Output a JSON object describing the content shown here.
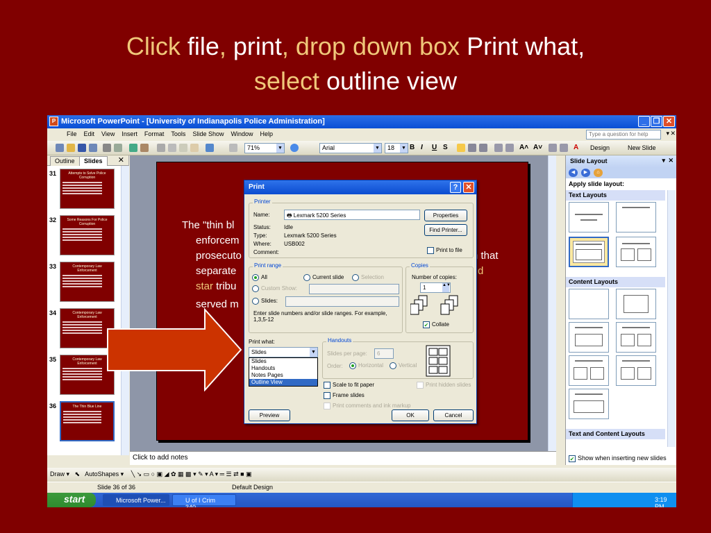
{
  "slide_title": {
    "parts": [
      {
        "text": "Click ",
        "accent": true
      },
      {
        "text": "file",
        "accent": false
      },
      {
        "text": ", ",
        "accent": true
      },
      {
        "text": "print",
        "accent": false
      },
      {
        "text": ", ",
        "accent": true
      },
      {
        "text": "drop down box ",
        "accent": true
      },
      {
        "text": "Print what,",
        "accent": false
      }
    ],
    "line2_accent": "select ",
    "line2_plain": "outline view"
  },
  "window": {
    "title": "Microsoft PowerPoint - [University of Indianapolis Police Administration]",
    "menu": [
      "File",
      "Edit",
      "View",
      "Insert",
      "Format",
      "Tools",
      "Slide Show",
      "Window",
      "Help"
    ],
    "help_placeholder": "Type a question for help",
    "zoom": "71%",
    "font": "Arial",
    "font_size": "18",
    "design_label": "Design",
    "new_slide_label": "New Slide"
  },
  "left_pane": {
    "tabs": [
      "Outline",
      "Slides"
    ],
    "thumbnails": [
      {
        "num": "31",
        "title": "Attempts to Solve Police Corruption"
      },
      {
        "num": "32",
        "title": "Some Reasons For Police Corruption"
      },
      {
        "num": "33",
        "title": "Contemporary Law Enforcement"
      },
      {
        "num": "34",
        "title": "Contemporary Law Enforcement"
      },
      {
        "num": "35",
        "title": "Contemporary Law Enforcement"
      },
      {
        "num": "36",
        "title": "The Thin Blue Line"
      }
    ]
  },
  "slide_body": {
    "line1": "The \"thin bl",
    "line2": "enforcem",
    "line3": "prosecuto",
    "line3_end": "n that",
    "line4": "separate",
    "line4_end": "d",
    "line5_accent": "star",
    "line5_plain": " tribu",
    "line6": "served m"
  },
  "notes_placeholder": "Click to add notes",
  "task_pane": {
    "title": "Slide Layout",
    "apply_label": "Apply slide layout:",
    "sections": [
      "Text Layouts",
      "Content Layouts",
      "Text and Content Layouts"
    ],
    "show_inserting": "Show when inserting new slides"
  },
  "drawbar": {
    "draw": "Draw",
    "autoshapes": "AutoShapes"
  },
  "status": {
    "slide": "Slide 36 of 36",
    "design": "Default Design"
  },
  "taskbar": {
    "start": "start",
    "items": [
      "Microsoft Power...",
      "U of I Crim 340-..."
    ],
    "time": "3:19 PM"
  },
  "print_dialog": {
    "title": "Print",
    "printer_group": "Printer",
    "name_label": "Name:",
    "printer_name": "Lexmark 5200 Series",
    "properties": "Properties",
    "find_printer": "Find Printer...",
    "status_label": "Status:",
    "status_value": "Idle",
    "type_label": "Type:",
    "type_value": "Lexmark 5200 Series",
    "where_label": "Where:",
    "where_value": "USB002",
    "comment_label": "Comment:",
    "print_to_file": "Print to file",
    "range_group": "Print range",
    "range_all": "All",
    "range_current": "Current slide",
    "range_selection": "Selection",
    "range_custom": "Custom Show:",
    "range_slides": "Slides:",
    "range_hint": "Enter slide numbers and/or slide ranges. For example, 1,3,5-12",
    "copies_group": "Copies",
    "copies_label": "Number of copies:",
    "copies_value": "1",
    "collate": "Collate",
    "print_what_label": "Print what:",
    "print_what_value": "Slides",
    "print_what_options": [
      "Slides",
      "Handouts",
      "Notes Pages",
      "Outline View"
    ],
    "print_what_highlight": "Outline View",
    "handouts_group": "Handouts",
    "slides_per_page_label": "Slides per page:",
    "slides_per_page_value": "6",
    "order_label": "Order:",
    "order_horizontal": "Horizontal",
    "order_vertical": "Vertical",
    "scale_to_fit": "Scale to fit paper",
    "frame_slides": "Frame slides",
    "print_comments": "Print comments and ink markup",
    "print_hidden": "Print hidden slides",
    "preview": "Preview",
    "ok": "OK",
    "cancel": "Cancel"
  },
  "colors": {
    "background": "#800000",
    "accent": "#f0c87a",
    "arrow_fill": "#cc3300"
  }
}
